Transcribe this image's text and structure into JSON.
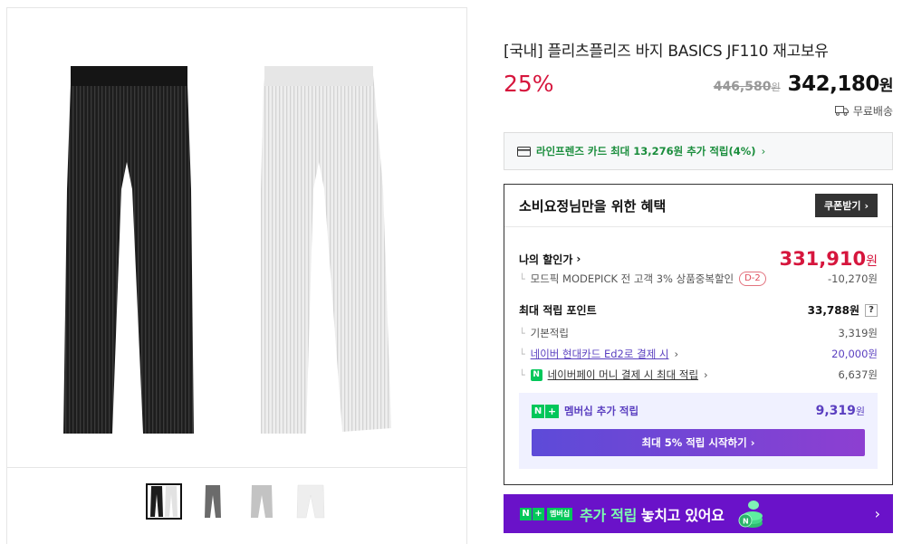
{
  "product": {
    "title": "[국내] 플리츠플리즈 바지 BASICS JF110 재고보유",
    "discount": "25%",
    "original_price": "446,580",
    "original_won": "원",
    "sale_price": "342,180",
    "sale_won": "원",
    "shipping": "무료배송"
  },
  "gallery": {
    "thumbnails": [
      "black",
      "darkgray",
      "lightgray",
      "white"
    ],
    "active_index": 0
  },
  "card_promo": "라인프렌즈 카드 최대 13,276원 추가 적립(4%)",
  "benefit": {
    "title": "소비요정님만을 위한 혜택",
    "coupon_label": "쿠폰받기",
    "my_price_label": "나의 할인가",
    "my_price": "331,910",
    "my_price_won": "원",
    "discount_line": "모드픽 MODEPICK 전 고객 3% 상품중복할인",
    "discount_badge": "D-2",
    "discount_value": "-10,270원",
    "points_label": "최대 적립 포인트",
    "points_value": "33,788원",
    "points_help": "?",
    "base_label": "기본적립",
    "base_value": "3,319원",
    "naver_card_label": "네이버 현대카드 Ed2로 결제 시",
    "naver_card_value": "20,000원",
    "npay_label": "네이버페이 머니 결제 시 최대 적립",
    "npay_value": "6,637원",
    "member_label": "멤버십 추가 적립",
    "member_value": "9,319",
    "member_won": "원",
    "start_button": "최대 5% 적립 시작하기"
  },
  "banner": {
    "badge_n": "N",
    "badge_plus": "+",
    "badge_member": "멤버십",
    "text_highlight": "추가 적립",
    "text_rest": "놓치고 있어요"
  },
  "colors": {
    "discount_red": "#d6163d",
    "green": "#1a8d3c",
    "naver_green": "#03c75a",
    "purple": "#5a3fc0",
    "banner_purple": "#6a12c9"
  }
}
